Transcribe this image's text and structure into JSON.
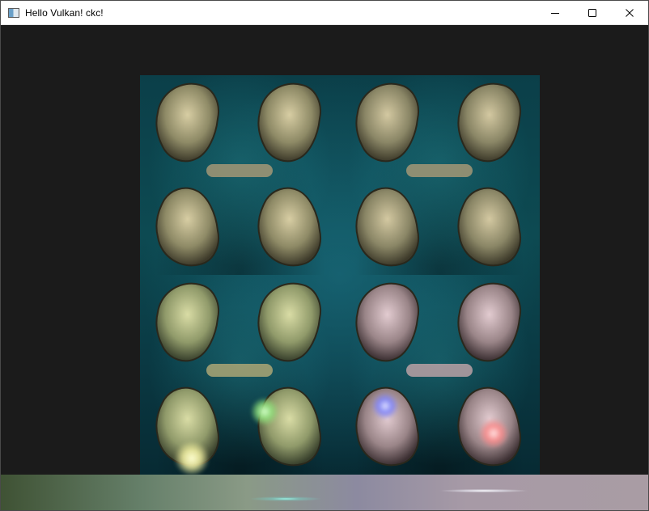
{
  "window": {
    "title": "Hello Vulkan! ckc!",
    "icon": "app-window-icon",
    "buttons": [
      {
        "name": "minimize-button",
        "icon": "minimize-icon"
      },
      {
        "name": "maximize-button",
        "icon": "maximize-icon"
      },
      {
        "name": "close-button",
        "icon": "close-icon"
      }
    ]
  },
  "scene": {
    "content": "statue-bust-tiles",
    "tiles": 4,
    "light_colors": {
      "yellow": "#f3f0a0",
      "green": "#8ee07a",
      "blue": "#7b82ff",
      "pink": "#ff8a8a",
      "cyan": "#b9fff4",
      "white": "#ffffff"
    },
    "background": "#1b1b1b"
  }
}
